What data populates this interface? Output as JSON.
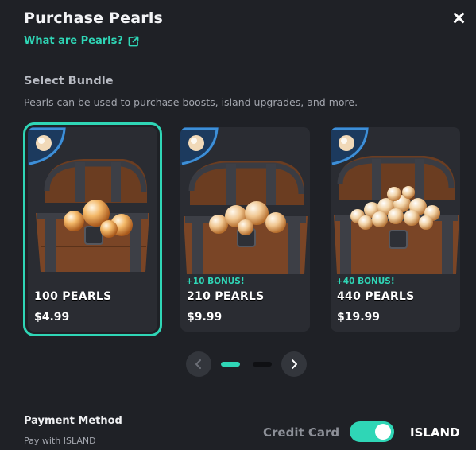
{
  "header": {
    "title": "Purchase Pearls",
    "close_icon": "close-icon",
    "what_link": "What are Pearls?",
    "link_icon": "external-link-icon"
  },
  "bundles_section": {
    "title": "Select Bundle",
    "subtitle": "Pearls can be used to purchase boosts, island upgrades, and more."
  },
  "bundles": [
    {
      "amount": "100 PEARLS",
      "price": "$4.99",
      "bonus": "",
      "selected": true
    },
    {
      "amount": "210 PEARLS",
      "price": "$9.99",
      "bonus": "+10 BONUS!",
      "selected": false
    },
    {
      "amount": "440 PEARLS",
      "price": "$19.99",
      "bonus": "+40 BONUS!",
      "selected": false
    }
  ],
  "pagination": {
    "prev_icon": "chevron-left-icon",
    "next_icon": "chevron-right-icon",
    "active_page": 1,
    "page_count": 2
  },
  "payment": {
    "title": "Payment Method",
    "subtitle": "Pay with ISLAND",
    "left_option": "Credit Card",
    "right_option": "ISLAND",
    "toggle_on": true
  },
  "colors": {
    "background": "#1f2126",
    "card": "#2a2c32",
    "accent": "#2fd6b6",
    "muted_text": "#a3a6ae"
  }
}
